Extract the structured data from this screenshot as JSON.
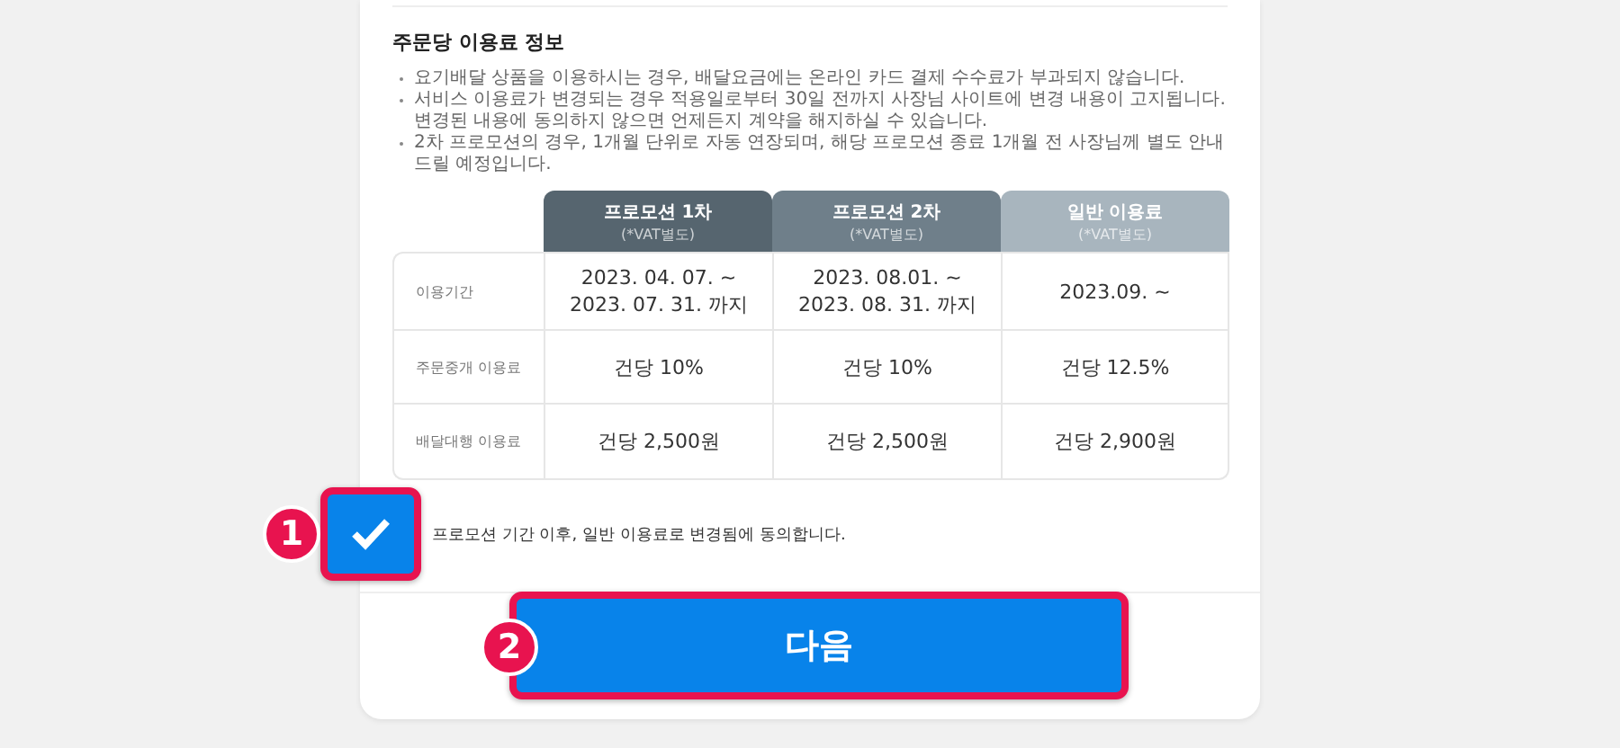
{
  "section_title": "주문당 이용료 정보",
  "notes": [
    "요기배달 상품을 이용하시는 경우, 배달요금에는 온라인 카드 결제 수수료가 부과되지 않습니다.",
    "서비스 이용료가 변경되는 경우 적용일로부터 30일 전까지 사장님 사이트에 변경 내용이 고지됩니다. 변경된 내용에 동의하지 않으면 언제든지 계약을 해지하실 수 있습니다.",
    "2차 프로모션의 경우, 1개월 단위로 자동 연장되며, 해당 프로모션 종료 1개월 전 사장님께 별도 안내드릴 예정입니다."
  ],
  "table": {
    "columns": [
      {
        "title": "프로모션 1차",
        "note": "(*VAT별도)",
        "color": "#56656f"
      },
      {
        "title": "프로모션 2차",
        "note": "(*VAT별도)",
        "color": "#6f7f8a"
      },
      {
        "title": "일반 이용료",
        "note": "(*VAT별도)",
        "color": "#a8b5be"
      }
    ],
    "rows": [
      {
        "label": "이용기간",
        "cells": [
          "2023. 04. 07. ~\n2023. 07. 31. 까지",
          "2023. 08.01. ~\n2023. 08. 31. 까지",
          "2023.09. ~"
        ]
      },
      {
        "label": "주문중개 이용료",
        "cells": [
          "건당 10%",
          "건당 10%",
          "건당 12.5%"
        ]
      },
      {
        "label": "배달대행 이용료",
        "cells": [
          "건당 2,500원",
          "건당 2,500원",
          "건당 2,900원"
        ]
      }
    ]
  },
  "agreement": {
    "label": "프로모션 기간 이후, 일반 이용료로 변경됨에 동의합니다.",
    "checked": true,
    "step": "1"
  },
  "next_button": {
    "label": "다음",
    "step": "2"
  }
}
